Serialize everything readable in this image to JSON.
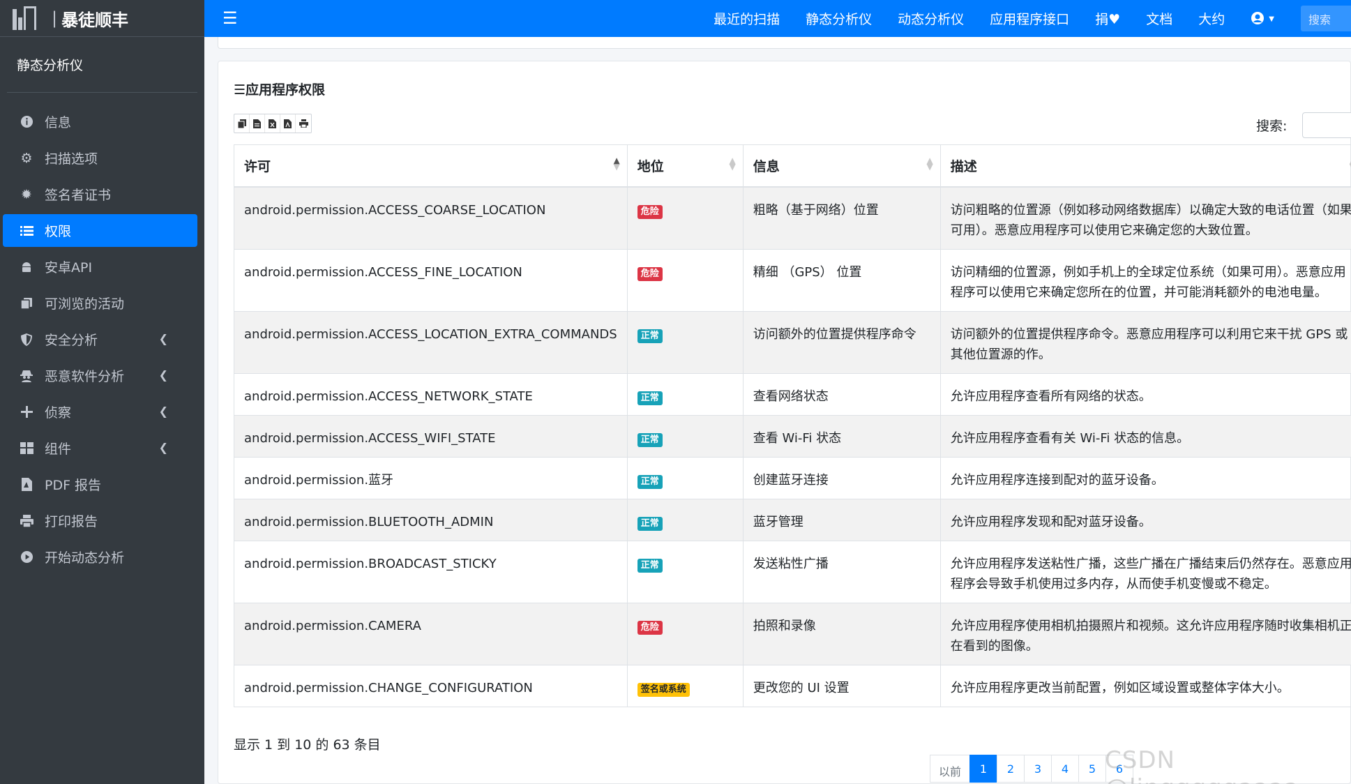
{
  "brand": {
    "logo_text": "iM",
    "name": "暴徒顺丰"
  },
  "sidebar": {
    "section_title": "静态分析仪",
    "items": [
      {
        "label": "信息",
        "icon": "info-circle-icon"
      },
      {
        "label": "扫描选项",
        "icon": "gear-icon"
      },
      {
        "label": "签名者证书",
        "icon": "certificate-icon"
      },
      {
        "label": "权限",
        "icon": "list-icon",
        "active": true
      },
      {
        "label": "安卓API",
        "icon": "android-icon"
      },
      {
        "label": "可浏览的活动",
        "icon": "copy-icon"
      },
      {
        "label": "安全分析",
        "icon": "shield-icon",
        "expandable": true
      },
      {
        "label": "恶意软件分析",
        "icon": "spy-icon",
        "expandable": true
      },
      {
        "label": "侦察",
        "icon": "plus-icon",
        "expandable": true
      },
      {
        "label": "组件",
        "icon": "grid-icon",
        "expandable": true
      },
      {
        "label": "PDF 报告",
        "icon": "pdf-file-icon"
      },
      {
        "label": "打印报告",
        "icon": "printer-icon"
      },
      {
        "label": "开始动态分析",
        "icon": "play-circle-icon"
      }
    ]
  },
  "topbar": {
    "links": [
      "最近的扫描",
      "静态分析仪",
      "动态分析仪",
      "应用程序接口",
      "捐♥",
      "文档",
      "大约"
    ],
    "user_icon": "user-circle-icon",
    "search_placeholder": "搜索"
  },
  "card": {
    "title": "☰应用程序权限",
    "search_label": "搜索:",
    "tools": [
      "copy-icon",
      "csv-icon",
      "excel-icon",
      "pdf-icon",
      "print-icon"
    ]
  },
  "table": {
    "headers": [
      "许可",
      "地位",
      "信息",
      "描述"
    ],
    "rows": [
      {
        "permission": "android.permission.ACCESS_COARSE_LOCATION",
        "status": "危险",
        "status_type": "danger",
        "info": "粗略（基于网络）位置",
        "description": "访问粗略的位置源（例如移动网络数据库）以确定大致的电话位置（如果可用）。恶意应用程序可以使用它来确定您的大致位置。"
      },
      {
        "permission": "android.permission.ACCESS_FINE_LOCATION",
        "status": "危险",
        "status_type": "danger",
        "info": "精细 （GPS） 位置",
        "description": "访问精细的位置源，例如手机上的全球定位系统（如果可用）。恶意应用程序可以使用它来确定您所在的位置，并可能消耗额外的电池电量。"
      },
      {
        "permission": "android.permission.ACCESS_LOCATION_EXTRA_COMMANDS",
        "status": "正常",
        "status_type": "info",
        "info": "访问额外的位置提供程序命令",
        "description": "访问额外的位置提供程序命令。恶意应用程序可以利用它来干扰 GPS 或其他位置源的作。"
      },
      {
        "permission": "android.permission.ACCESS_NETWORK_STATE",
        "status": "正常",
        "status_type": "info",
        "info": "查看网络状态",
        "description": "允许应用程序查看所有网络的状态。"
      },
      {
        "permission": "android.permission.ACCESS_WIFI_STATE",
        "status": "正常",
        "status_type": "info",
        "info": "查看 Wi-Fi 状态",
        "description": "允许应用程序查看有关 Wi-Fi 状态的信息。"
      },
      {
        "permission": "android.permission.蓝牙",
        "status": "正常",
        "status_type": "info",
        "info": "创建蓝牙连接",
        "description": "允许应用程序连接到配对的蓝牙设备。"
      },
      {
        "permission": "android.permission.BLUETOOTH_ADMIN",
        "status": "正常",
        "status_type": "info",
        "info": "蓝牙管理",
        "description": "允许应用程序发现和配对蓝牙设备。"
      },
      {
        "permission": "android.permission.BROADCAST_STICKY",
        "status": "正常",
        "status_type": "info",
        "info": "发送粘性广播",
        "description": "允许应用程序发送粘性广播，这些广播在广播结束后仍然存在。恶意应用程序会导致手机使用过多内存，从而使手机变慢或不稳定。"
      },
      {
        "permission": "android.permission.CAMERA",
        "status": "危险",
        "status_type": "danger",
        "info": "拍照和录像",
        "description": "允许应用程序使用相机拍摄照片和视频。这允许应用程序随时收集相机正在看到的图像。"
      },
      {
        "permission": "android.permission.CHANGE_CONFIGURATION",
        "status": "签名或系统",
        "status_type": "warning",
        "info": "更改您的 UI 设置",
        "description": "允许应用程序更改当前配置，例如区域设置或整体字体大小。"
      }
    ]
  },
  "footer": {
    "info": "显示 1 到 10 的 63 条目",
    "pagination": [
      "以前",
      "1",
      "2",
      "3",
      "4",
      "5",
      "6"
    ],
    "current_page": "1",
    "watermark": "CSDN @lingggggaaaa"
  }
}
